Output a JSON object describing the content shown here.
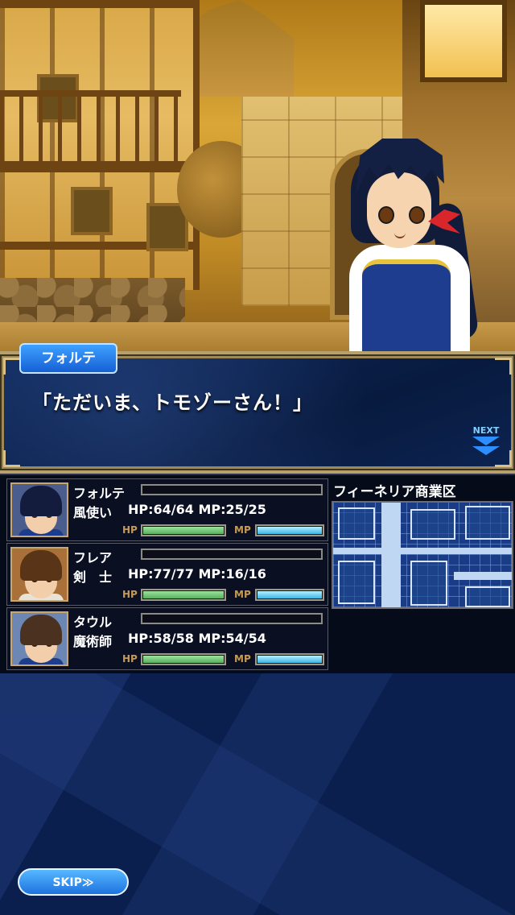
{
  "scene": {
    "speaker": "フォルテ",
    "line": "「ただいま、トモゾーさん！」",
    "next_label": "NEXT"
  },
  "party": [
    {
      "name": "フォルテ",
      "class": "風使い",
      "hp_mp_text": "HP:64/64 MP:25/25",
      "hp_label": "HP",
      "mp_label": "MP",
      "hp_fraction": 1.0,
      "mp_fraction": 1.0,
      "hair_color": "#141c3e",
      "shirt_color": "#1c3c8e",
      "portrait_bg": "#4b5d8c"
    },
    {
      "name": "フレア",
      "class": "剣　士",
      "hp_mp_text": "HP:77/77 MP:16/16",
      "hp_label": "HP",
      "mp_label": "MP",
      "hp_fraction": 1.0,
      "mp_fraction": 1.0,
      "hair_color": "#5a3416",
      "shirt_color": "#e9e3d6",
      "portrait_bg": "#a9703a"
    },
    {
      "name": "タウル",
      "class": "魔術師",
      "hp_mp_text": "HP:58/58 MP:54/54",
      "hp_label": "HP",
      "mp_label": "MP",
      "hp_fraction": 1.0,
      "mp_fraction": 1.0,
      "hair_color": "#4b3220",
      "shirt_color": "#1c3e8c",
      "portrait_bg": "#6c87b3"
    }
  ],
  "map": {
    "area_name": "フィーネリア商業区"
  },
  "controls": {
    "skip_label": "SKIP≫"
  },
  "colors": {
    "hp_bar": "#5dbc63",
    "mp_bar": "#3cb7e6",
    "panel_bg": "#0b1f4f",
    "accent_button": "#2a86ee"
  },
  "icons": {
    "next": "chevron-double-down-icon"
  }
}
